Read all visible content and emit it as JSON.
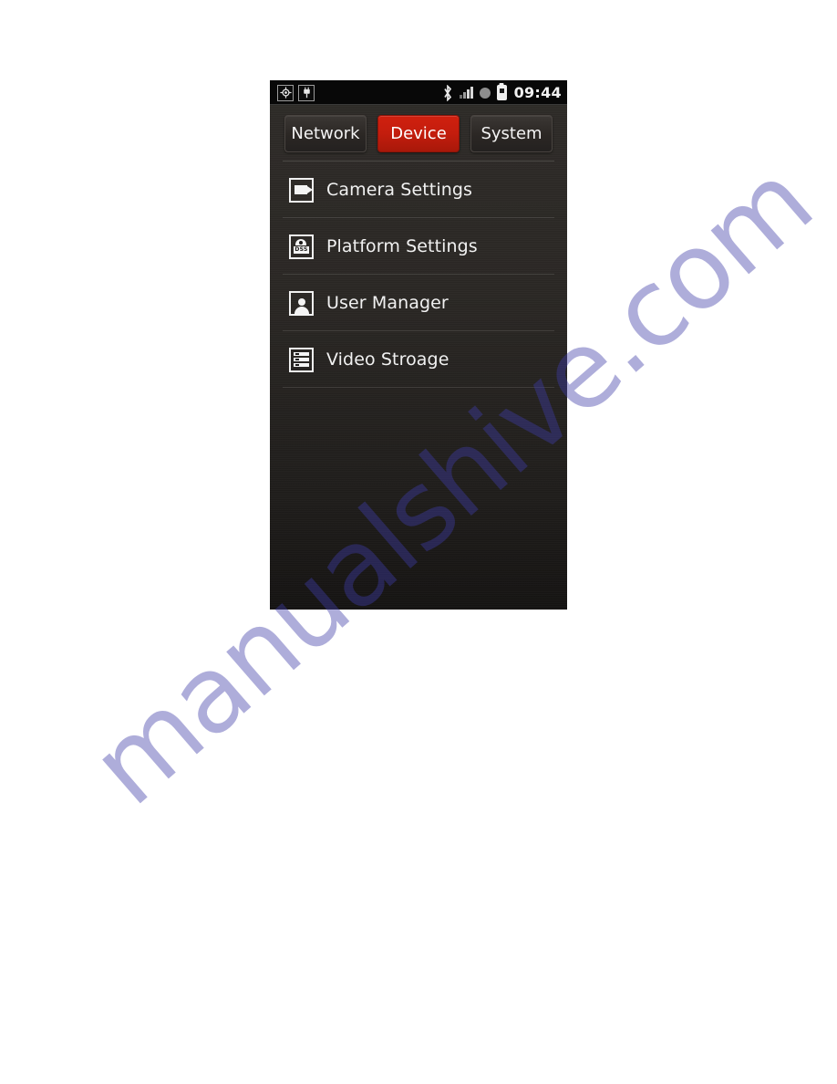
{
  "watermark": {
    "text": "manualshive.com"
  },
  "status_bar": {
    "left_icons": [
      {
        "name": "gps-icon",
        "glyph": "◉"
      },
      {
        "name": "usb-plug-icon",
        "glyph": "⚲"
      }
    ],
    "right_icons": [
      {
        "name": "bluetooth-icon"
      },
      {
        "name": "signal-bars-icon"
      },
      {
        "name": "alarm-dot-icon"
      },
      {
        "name": "battery-icon"
      }
    ],
    "clock": "09:44"
  },
  "tabs": [
    {
      "label": "Network",
      "active": false
    },
    {
      "label": "Device",
      "active": true
    },
    {
      "label": "System",
      "active": false
    }
  ],
  "list": {
    "items": [
      {
        "label": "Camera Settings",
        "icon": "video-camera-icon"
      },
      {
        "label": "Platform Settings",
        "icon": "dss-platform-icon",
        "icon_text": "DSS"
      },
      {
        "label": "User Manager",
        "icon": "user-icon"
      },
      {
        "label": "Video Stroage",
        "icon": "storage-rack-icon"
      }
    ]
  },
  "colors": {
    "accent_red": "#c31d0d",
    "screen_bg": "#2a2724",
    "status_bar_bg": "#080808",
    "text": "#f1f1f1",
    "watermark": "#3f3ca8"
  }
}
